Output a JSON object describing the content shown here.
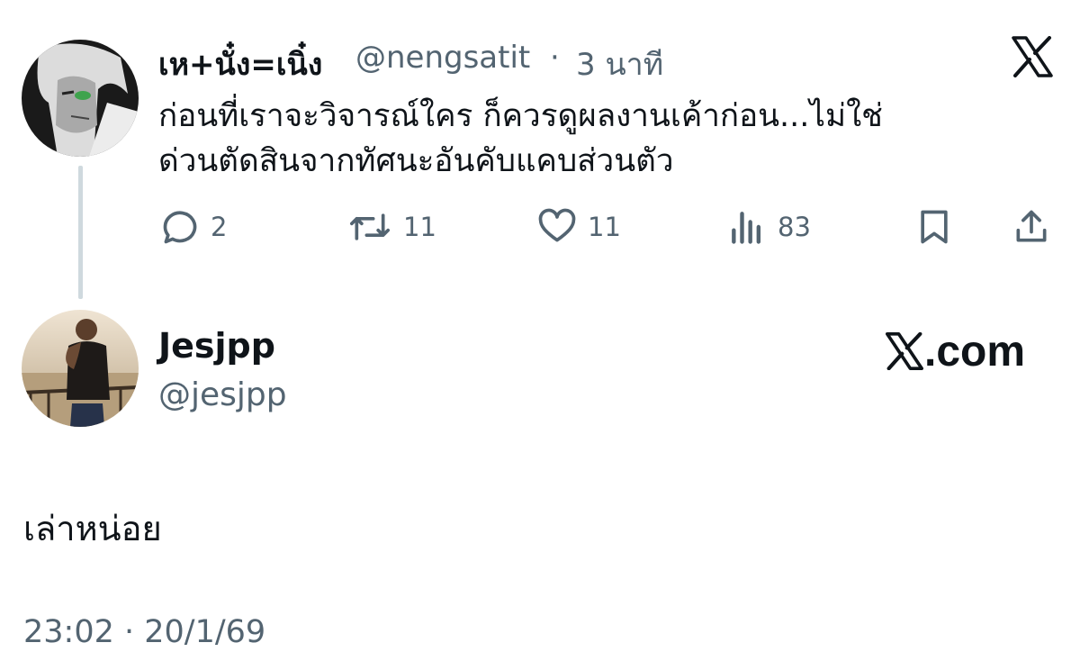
{
  "quoted_tweet": {
    "display_name": "เห+นั๋ง=เนิ๋ง",
    "handle": "@nengsatit",
    "separator": "·",
    "time_ago": "3 นาที",
    "text_line1": "ก่อนที่เราจะวิจารณ์ใคร ก็ควรดูผลงานเค้าก่อน...ไม่ใช่",
    "text_line2": "ด่วนตัดสินจากทัศนะอันคับแคบส่วนตัว",
    "actions": {
      "replies": "2",
      "reposts": "11",
      "likes": "11",
      "views": "83"
    }
  },
  "reply_tweet": {
    "display_name": "Jesjpp",
    "handle": "@jesjpp",
    "text": "เล่าหน่อย",
    "timestamp": "23:02 · 20/1/69"
  },
  "branding": {
    "xcom_suffix": ".com"
  },
  "icons": {
    "top_logo": "x-logo-icon",
    "reply": "reply-icon",
    "repost": "repost-icon",
    "like": "heart-icon",
    "views": "views-icon",
    "bookmark": "bookmark-icon",
    "share": "share-icon"
  },
  "colors": {
    "text": "#0f1419",
    "secondary": "#536471",
    "thread_line": "#cfd9de"
  }
}
